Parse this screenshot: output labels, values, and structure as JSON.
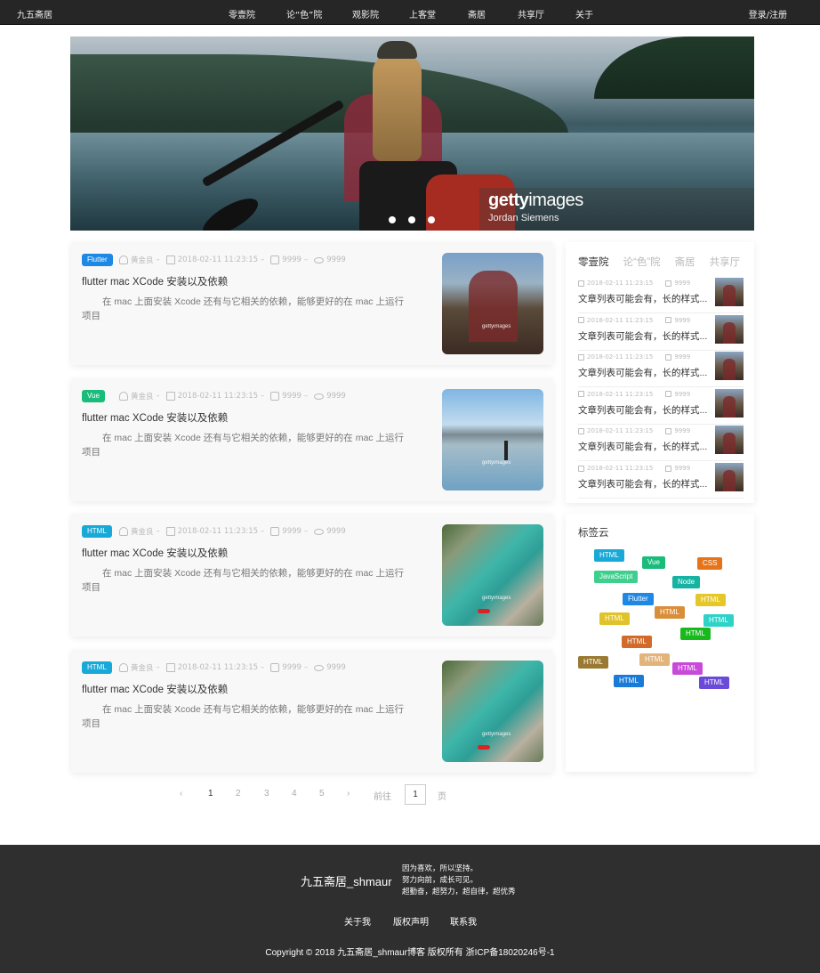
{
  "header": {
    "brand": "九五斋居",
    "nav": [
      "零壹院",
      "论“色”院",
      "观影院",
      "上客堂",
      "斋居",
      "共享厅",
      "关于"
    ],
    "login": "登录/注册"
  },
  "banner": {
    "watermark_brand": "gettyimages",
    "watermark_credit": "Jordan Siemens",
    "slide_count": 3
  },
  "articles": [
    {
      "tag": "Flutter",
      "tag_color": "#1e88e5",
      "author": "黄金良",
      "date": "2018-02-11 11:23:15",
      "comments": "9999",
      "views": "9999",
      "title": "flutter mac XCode 安装以及依赖",
      "desc": "在 mac 上面安装 Xcode 还有与它相关的依赖，能够更好的在 mac 上运行项目",
      "image": "crowd-photo"
    },
    {
      "tag": "Vue",
      "tag_color": "#1abc7c",
      "author": "黄金良",
      "date": "2018-02-11 11:23:15",
      "comments": "9999",
      "views": "9999",
      "title": "flutter mac XCode 安装以及依赖",
      "desc": "在 mac 上面安装 Xcode 还有与它相关的依赖，能够更好的在 mac 上运行项目",
      "image": "lake-photo"
    },
    {
      "tag": "HTML",
      "tag_color": "#19a9d8",
      "author": "黄金良",
      "date": "2018-02-11 11:23:15",
      "comments": "9999",
      "views": "9999",
      "title": "flutter mac XCode 安装以及依赖",
      "desc": "在 mac 上面安装 Xcode 还有与它相关的依赖，能够更好的在 mac 上运行项目",
      "image": "river-photo"
    },
    {
      "tag": "HTML",
      "tag_color": "#19a9d8",
      "author": "黄金良",
      "date": "2018-02-11 11:23:15",
      "comments": "9999",
      "views": "9999",
      "title": "flutter mac XCode 安装以及依赖",
      "desc": "在 mac 上面安装 Xcode 还有与它相关的依赖，能够更好的在 mac 上运行项目",
      "image": "river-photo"
    }
  ],
  "sidebar": {
    "tabs": [
      "零壹院",
      "论“色”院",
      "斋居",
      "共享厅"
    ],
    "items": [
      {
        "date": "2018-02-11 11:23:15",
        "count": "9999",
        "text": "文章列表可能会有，长的样式..."
      },
      {
        "date": "2018-02-11 11:23:15",
        "count": "9999",
        "text": "文章列表可能会有，长的样式..."
      },
      {
        "date": "2018-02-11 11:23:15",
        "count": "9999",
        "text": "文章列表可能会有，长的样式..."
      },
      {
        "date": "2018-02-11 11:23:15",
        "count": "9999",
        "text": "文章列表可能会有，长的样式..."
      },
      {
        "date": "2018-02-11 11:23:15",
        "count": "9999",
        "text": "文章列表可能会有，长的样式..."
      },
      {
        "date": "2018-02-11 11:23:15",
        "count": "9999",
        "text": "文章列表可能会有，长的样式..."
      }
    ]
  },
  "tag_cloud": {
    "title": "标签云",
    "tags": [
      {
        "label": "HTML",
        "color": "#19a9d8"
      },
      {
        "label": "Vue",
        "color": "#1abc7c"
      },
      {
        "label": "CSS",
        "color": "#e8741a"
      },
      {
        "label": "JavaScript",
        "color": "#3ecf8e"
      },
      {
        "label": "Node",
        "color": "#16b3a2"
      },
      {
        "label": "Flutter",
        "color": "#1e88e5"
      },
      {
        "label": "HTML",
        "color": "#e6c72a"
      },
      {
        "label": "HTML",
        "color": "#e0c22a"
      },
      {
        "label": "HTML",
        "color": "#d98e3a"
      },
      {
        "label": "HTML",
        "color": "#2ed3c8"
      },
      {
        "label": "HTML",
        "color": "#19b91e"
      },
      {
        "label": "HTML",
        "color": "#d26a2a"
      },
      {
        "label": "HTML",
        "color": "#9a7a32"
      },
      {
        "label": "HTML",
        "color": "#e2b47a"
      },
      {
        "label": "HTML",
        "color": "#c84ad8"
      },
      {
        "label": "HTML",
        "color": "#1a7ad8"
      },
      {
        "label": "HTML",
        "color": "#6a4ad8"
      }
    ]
  },
  "pagination": {
    "pages": [
      "1",
      "2",
      "3",
      "4",
      "5"
    ],
    "current": "1",
    "goto_label": "前往",
    "goto_value": "1",
    "page_suffix": "页"
  },
  "footer": {
    "brand": "九五斋居_shmaur",
    "motto": [
      "因为喜欢，所以坚持。",
      "努力向前，成长可见。",
      "超勤奋，超努力，超自律，超优秀"
    ],
    "links": [
      "关于我",
      "版权声明",
      "联系我"
    ],
    "copyright": "Copyright © 2018 九五斋居_shmaur博客 版权所有 浙ICP备18020246号-1"
  }
}
